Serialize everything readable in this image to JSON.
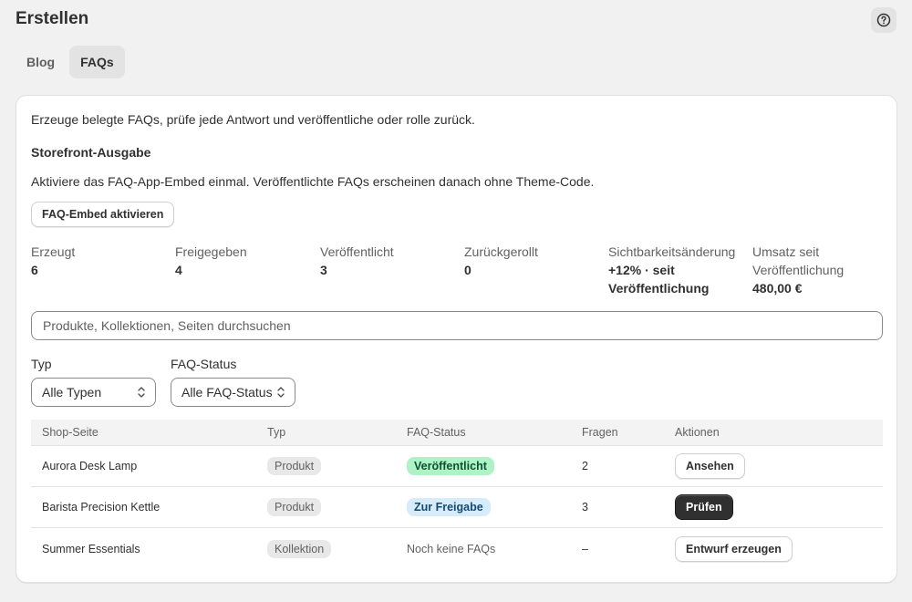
{
  "header": {
    "title": "Erstellen",
    "help_icon": "question-circle-icon"
  },
  "tabs": [
    {
      "label": "Blog",
      "active": false
    },
    {
      "label": "FAQs",
      "active": true
    }
  ],
  "card": {
    "intro": "Erzeuge belegte FAQs, prüfe jede Antwort und veröffentliche oder rolle zurück.",
    "section_title": "Storefront-Ausgabe",
    "section_desc": "Aktiviere das FAQ-App-Embed einmal. Veröffentlichte FAQs erscheinen danach ohne Theme-Code.",
    "embed_button": "FAQ-Embed aktivieren"
  },
  "stats": [
    {
      "label": "Erzeugt",
      "value": "6"
    },
    {
      "label": "Freigegeben",
      "value": "4"
    },
    {
      "label": "Veröffentlicht",
      "value": "3"
    },
    {
      "label": "Zurückgerollt",
      "value": "0"
    },
    {
      "label": "Sichtbarkeitsänderung",
      "value_line1": "+12% · seit",
      "value_line2": "Veröffentlichung"
    },
    {
      "label_line1": "Umsatz seit",
      "label_line2": "Veröffentlichung",
      "value": "480,00 €"
    }
  ],
  "search": {
    "placeholder": "Produkte, Kollektionen, Seiten durchsuchen"
  },
  "filters": {
    "type": {
      "label": "Typ",
      "selected": "Alle Typen"
    },
    "status": {
      "label": "FAQ-Status",
      "selected": "Alle FAQ-Status"
    }
  },
  "table": {
    "headers": [
      "Shop-Seite",
      "Typ",
      "FAQ-Status",
      "Fragen",
      "Aktionen"
    ],
    "rows": [
      {
        "page": "Aurora Desk Lamp",
        "type": "Produkt",
        "status": "Veröffentlicht",
        "questions": "2",
        "action": "Ansehen"
      },
      {
        "page": "Barista Precision Kettle",
        "type": "Produkt",
        "status": "Zur Freigabe",
        "questions": "3",
        "action": "Prüfen"
      },
      {
        "page": "Summer Essentials",
        "type": "Kollektion",
        "status": "Noch keine FAQs",
        "questions": "–",
        "action": "Entwurf erzeugen"
      }
    ]
  },
  "colors": {
    "published_badge_bg": "#aff2c5",
    "review_badge_bg": "#d7ecfb",
    "primary_button": "#303030"
  }
}
